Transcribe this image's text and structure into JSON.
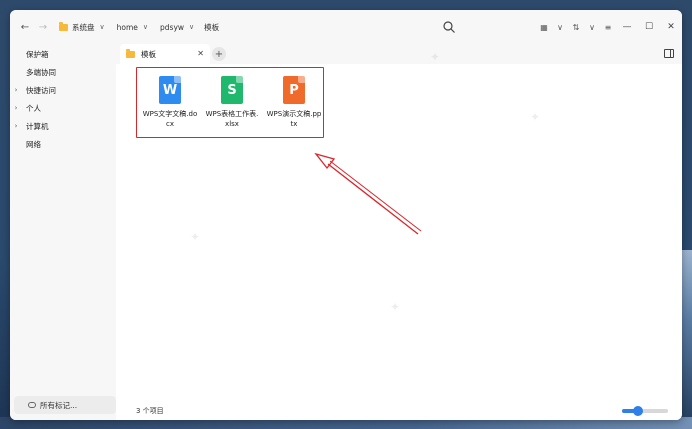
{
  "breadcrumb": [
    "系统盘",
    "home",
    "pdsyw",
    "模板"
  ],
  "tab": {
    "label": "模板"
  },
  "sidebar": {
    "items": [
      {
        "label": "保护箱",
        "arrow": ""
      },
      {
        "label": "多端协同",
        "arrow": ""
      },
      {
        "label": "快捷访问",
        "arrow": "›"
      },
      {
        "label": "个人",
        "arrow": "›"
      },
      {
        "label": "计算机",
        "arrow": "›"
      },
      {
        "label": "网络",
        "arrow": ""
      }
    ],
    "bottom_label": "所有标记..."
  },
  "files": [
    {
      "name": "WPS文字文稿.docx",
      "glyph": "W",
      "color": "#2e8bf0"
    },
    {
      "name": "WPS表格工作表.xlsx",
      "glyph": "S",
      "color": "#1fb86d"
    },
    {
      "name": "WPS演示文稿.pptx",
      "glyph": "P",
      "color": "#f06a2c"
    }
  ],
  "status": {
    "count": "3 个项目"
  },
  "zoom": {
    "level": 0.3
  },
  "annotation_color": "#d9262b"
}
